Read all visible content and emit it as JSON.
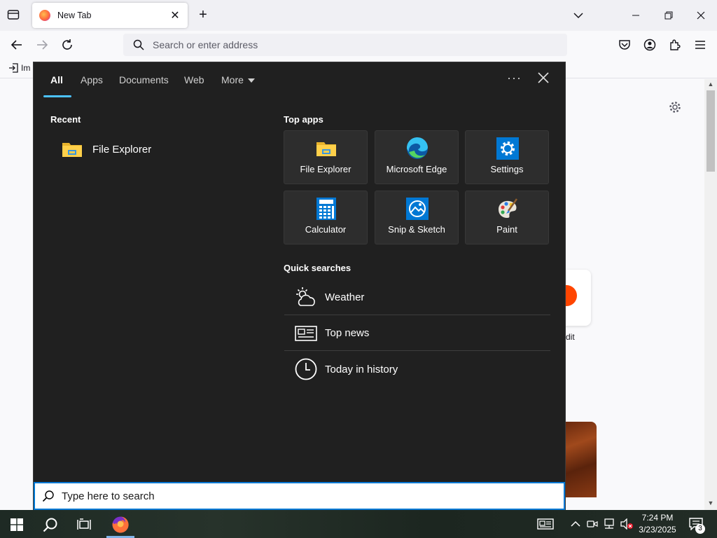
{
  "browser": {
    "tab": {
      "title": "New Tab"
    },
    "url_placeholder": "Search or enter address",
    "bookmark_item": "Im",
    "shortcut_label": "dit"
  },
  "search_panel": {
    "tabs": [
      {
        "label": "All",
        "active": true
      },
      {
        "label": "Apps"
      },
      {
        "label": "Documents"
      },
      {
        "label": "Web"
      },
      {
        "label": "More"
      }
    ],
    "more_options": "···",
    "recent_title": "Recent",
    "recent_items": [
      {
        "label": "File Explorer",
        "icon": "file-explorer-icon"
      }
    ],
    "top_apps_title": "Top apps",
    "top_apps": [
      {
        "label": "File Explorer",
        "icon": "file-explorer-icon"
      },
      {
        "label": "Microsoft Edge",
        "icon": "edge-icon"
      },
      {
        "label": "Settings",
        "icon": "settings-gear-icon"
      },
      {
        "label": "Calculator",
        "icon": "calculator-icon"
      },
      {
        "label": "Snip & Sketch",
        "icon": "snip-sketch-icon"
      },
      {
        "label": "Paint",
        "icon": "paint-palette-icon"
      }
    ],
    "quick_searches_title": "Quick searches",
    "quick_searches": [
      {
        "label": "Weather",
        "icon": "weather-icon"
      },
      {
        "label": "Top news",
        "icon": "news-icon"
      },
      {
        "label": "Today in history",
        "icon": "clock-icon"
      }
    ],
    "search_placeholder": "Type here to search"
  },
  "taskbar": {
    "time": "7:24 PM",
    "date": "3/23/2025",
    "notification_count": "3"
  },
  "colors": {
    "panel_bg": "#202020",
    "tile_bg": "#2d2d2d",
    "accent": "#4cc2ff",
    "search_border": "#0078d4"
  }
}
